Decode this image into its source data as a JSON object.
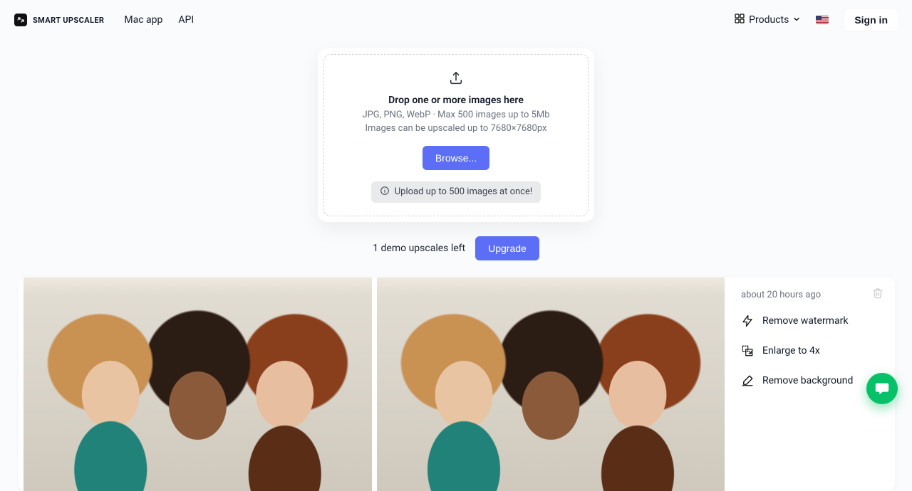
{
  "header": {
    "brand": "SMART UPSCALER",
    "nav": {
      "mac_app": "Mac app",
      "api": "API"
    },
    "products_label": "Products",
    "signin_label": "Sign in",
    "locale_flag": "us"
  },
  "dropzone": {
    "title": "Drop one or more images here",
    "subtitle_line1": "JPG, PNG, WebP · Max 500 images up to 5Mb",
    "subtitle_line2": "Images can be upscaled up to 7680×7680px",
    "browse_label": "Browse...",
    "info_pill": "Upload up to 500 images at once!"
  },
  "demo": {
    "remaining_text": "1 demo upscales left",
    "upgrade_label": "Upgrade"
  },
  "result": {
    "timestamp": "about 20 hours ago",
    "actions": {
      "remove_watermark": "Remove watermark",
      "enlarge_4x": "Enlarge to 4x",
      "remove_background": "Remove background"
    }
  },
  "icons": {
    "logo": "upscaler-logo-icon",
    "grid": "grid-icon",
    "chevron_down": "chevron-down-icon",
    "upload": "upload-icon",
    "info": "info-icon",
    "trash": "trash-icon",
    "bolt": "bolt-icon",
    "enlarge": "enlarge-icon",
    "erase": "erase-icon",
    "chat": "chat-icon"
  },
  "colors": {
    "primary": "#5b6ef5",
    "chat": "#06c167"
  }
}
